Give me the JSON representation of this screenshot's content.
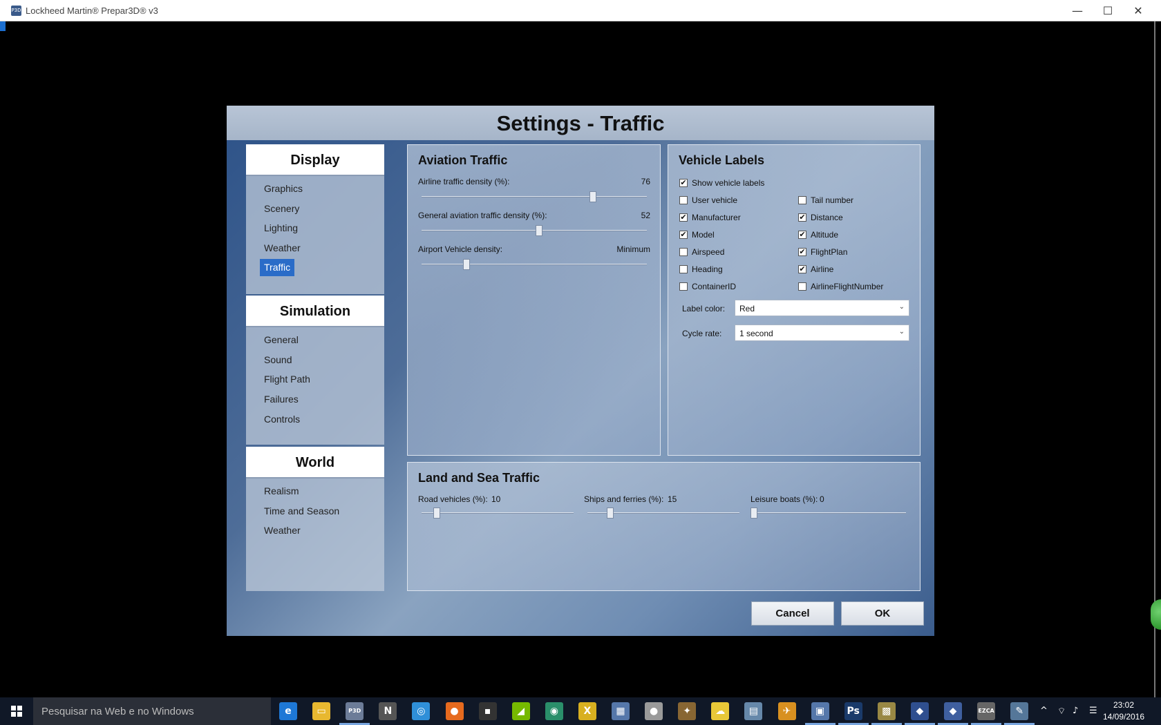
{
  "window": {
    "icon_text": "P3D",
    "title": "Lockheed Martin® Prepar3D® v3",
    "minimize": "—",
    "maximize": "☐",
    "close": "✕"
  },
  "dialog": {
    "title": "Settings - Traffic"
  },
  "nav": {
    "display": {
      "heading": "Display",
      "items": [
        "Graphics",
        "Scenery",
        "Lighting",
        "Weather",
        "Traffic"
      ],
      "active": "Traffic"
    },
    "simulation": {
      "heading": "Simulation",
      "items": [
        "General",
        "Sound",
        "Flight Path",
        "Failures",
        "Controls"
      ]
    },
    "world": {
      "heading": "World",
      "items": [
        "Realism",
        "Time and Season",
        "Weather"
      ]
    }
  },
  "aviation": {
    "title": "Aviation Traffic",
    "airline": {
      "label": "Airline traffic density (%):",
      "value": "76",
      "level": 0.76
    },
    "general": {
      "label": "General aviation traffic density (%):",
      "value": "52",
      "level": 0.52
    },
    "vehicle": {
      "label": "Airport Vehicle density:",
      "value": "Minimum",
      "level": 0.2
    }
  },
  "labels": {
    "title": "Vehicle Labels",
    "show": {
      "label": "Show vehicle labels",
      "checked": true
    },
    "left": [
      {
        "label": "User vehicle",
        "checked": false
      },
      {
        "label": "Manufacturer",
        "checked": true
      },
      {
        "label": "Model",
        "checked": true
      },
      {
        "label": "Airspeed",
        "checked": false
      },
      {
        "label": "Heading",
        "checked": false
      },
      {
        "label": "ContainerID",
        "checked": false
      }
    ],
    "right": [
      {
        "label": "Tail number",
        "checked": false
      },
      {
        "label": "Distance",
        "checked": true
      },
      {
        "label": "Altitude",
        "checked": true
      },
      {
        "label": "FlightPlan",
        "checked": true
      },
      {
        "label": "Airline",
        "checked": true
      },
      {
        "label": "AirlineFlightNumber",
        "checked": false
      }
    ],
    "label_color": {
      "label": "Label color:",
      "value": "Red"
    },
    "cycle_rate": {
      "label": "Cycle rate:",
      "value": "1 second"
    },
    "check_mark": "✔",
    "dropdown_arrow": "⌄"
  },
  "land_sea": {
    "title": "Land and Sea Traffic",
    "road": {
      "label": "Road vehicles (%):",
      "value": "10",
      "level": 0.1
    },
    "ships": {
      "label": "Ships and ferries (%):",
      "value": "15",
      "level": 0.15
    },
    "leisure": {
      "label": "Leisure boats (%):",
      "value": "0",
      "level": 0.0
    }
  },
  "buttons": {
    "cancel": "Cancel",
    "ok": "OK"
  },
  "taskbar": {
    "search_placeholder": "Pesquisar na Web e no Windows",
    "time": "23:02",
    "date": "14/09/2016",
    "icons": [
      {
        "name": "edge-icon",
        "glyph": "e",
        "color": "#1e78d6"
      },
      {
        "name": "file-explorer-icon",
        "glyph": "▭",
        "color": "#e8b830"
      },
      {
        "name": "prepar3d-icon",
        "glyph": "P3D",
        "color": "#6c7c98"
      },
      {
        "name": "n-app-icon",
        "glyph": "N",
        "color": "#555"
      },
      {
        "name": "globe-download-icon",
        "glyph": "◎",
        "color": "#2f8fd8"
      },
      {
        "name": "firefox-icon",
        "glyph": "●",
        "color": "#e66a1e"
      },
      {
        "name": "game-app-icon",
        "glyph": "▪",
        "color": "#333"
      },
      {
        "name": "nvidia-icon",
        "glyph": "◢",
        "color": "#76b900"
      },
      {
        "name": "earth-app-icon",
        "glyph": "◉",
        "color": "#2a8f6a"
      },
      {
        "name": "x-plane-icon",
        "glyph": "X",
        "color": "#d8b020"
      },
      {
        "name": "network-app-icon",
        "glyph": "▦",
        "color": "#5577aa"
      },
      {
        "name": "moon-app-icon",
        "glyph": "●",
        "color": "#9a9a9a"
      },
      {
        "name": "compass-app-icon",
        "glyph": "✦",
        "color": "#886633"
      },
      {
        "name": "weather-app-icon",
        "glyph": "☁",
        "color": "#e8c838"
      },
      {
        "name": "config-app-icon",
        "glyph": "▤",
        "color": "#6688aa"
      },
      {
        "name": "plane-app-icon",
        "glyph": "✈",
        "color": "#d89020"
      },
      {
        "name": "monitor-app-icon",
        "glyph": "▣",
        "color": "#5577aa"
      },
      {
        "name": "photoshop-icon",
        "glyph": "Ps",
        "color": "#1a3a6a"
      },
      {
        "name": "map-app-icon",
        "glyph": "▩",
        "color": "#998844"
      },
      {
        "name": "pilot-app-icon",
        "glyph": "◆",
        "color": "#2f4f8f"
      },
      {
        "name": "pilot2-app-icon",
        "glyph": "◆",
        "color": "#3f5f9f"
      },
      {
        "name": "ezca-icon",
        "glyph": "EZCA",
        "color": "#666"
      },
      {
        "name": "paint-app-icon",
        "glyph": "✎",
        "color": "#557799"
      }
    ],
    "tray_chevron": "^",
    "tray_network": "⌔",
    "tray_volume": "♪",
    "tray_notifications": "☰"
  }
}
